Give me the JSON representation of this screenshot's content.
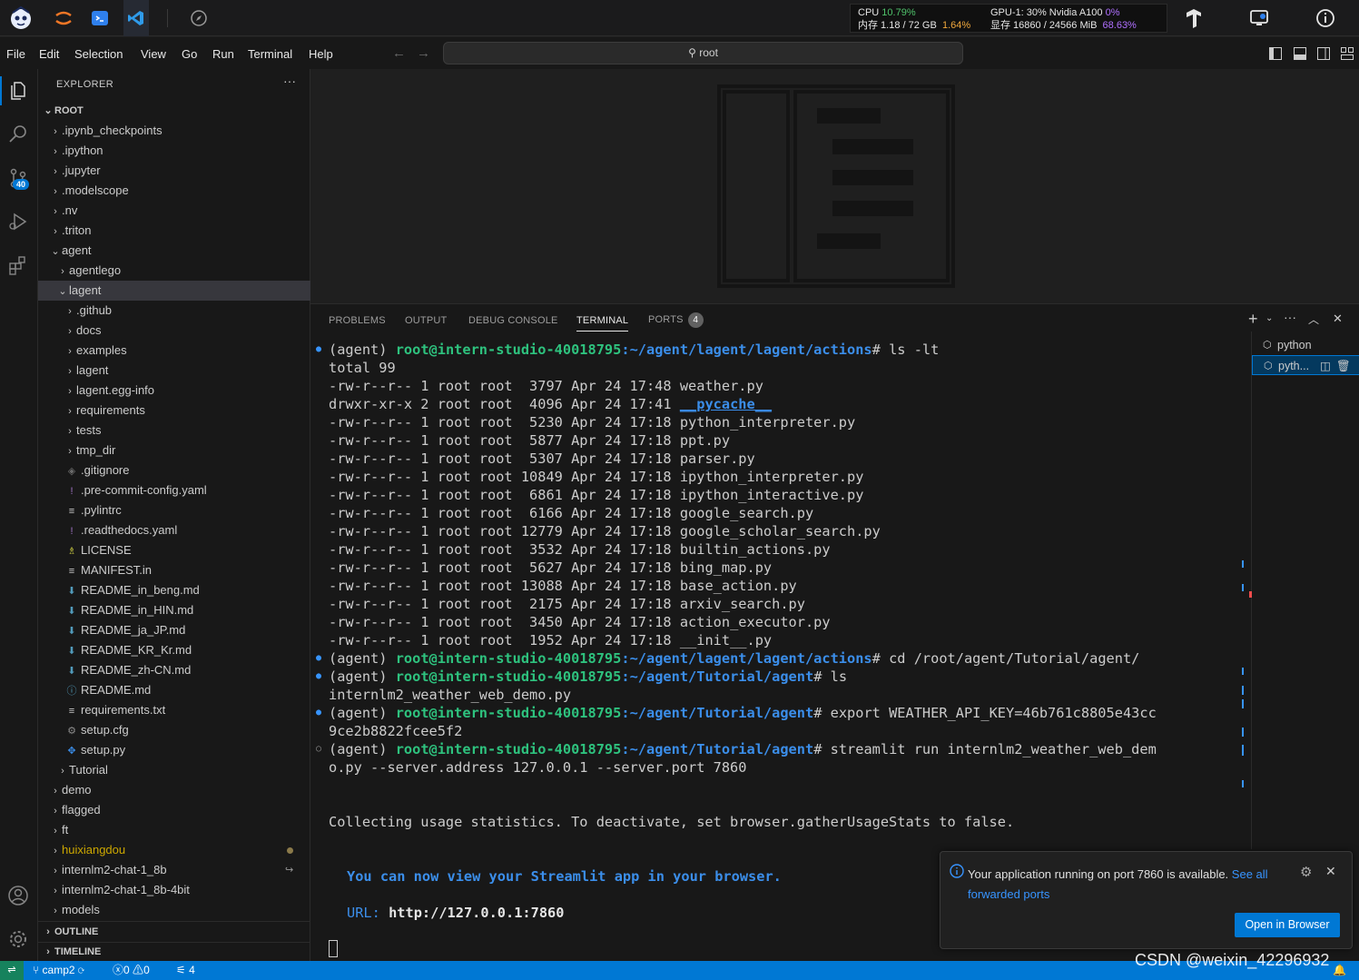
{
  "topbar": {
    "stats": {
      "cpu_label": "CPU",
      "cpu_value": "10.79%",
      "mem_label": "内存 1.18 / 72 GB",
      "mem_value": "1.64%",
      "gpu_label": "GPU-1: 30% Nvidia A100",
      "gpu_value": "0%",
      "vram_label": "显存 16860 / 24566 MiB",
      "vram_value": "68.63%"
    }
  },
  "menubar": {
    "items": [
      "File",
      "Edit",
      "Selection",
      "View",
      "Go",
      "Run",
      "Terminal",
      "Help"
    ],
    "search_text": "root"
  },
  "activity": {
    "scm_badge": "40"
  },
  "sidebar": {
    "title": "EXPLORER",
    "root_label": "ROOT",
    "rows": [
      {
        "label": ".ipynb_checkpoints"
      },
      {
        "label": ".ipython"
      },
      {
        "label": ".jupyter"
      },
      {
        "label": ".modelscope"
      },
      {
        "label": ".nv"
      },
      {
        "label": ".triton"
      },
      {
        "label": "agent"
      },
      {
        "label": "agentlego"
      },
      {
        "label": "lagent"
      },
      {
        "label": ".github"
      },
      {
        "label": "docs"
      },
      {
        "label": "examples"
      },
      {
        "label": "lagent"
      },
      {
        "label": "lagent.egg-info"
      },
      {
        "label": "requirements"
      },
      {
        "label": "tests"
      },
      {
        "label": "tmp_dir"
      },
      {
        "label": ".gitignore"
      },
      {
        "label": ".pre-commit-config.yaml"
      },
      {
        "label": ".pylintrc"
      },
      {
        "label": ".readthedocs.yaml"
      },
      {
        "label": "LICENSE"
      },
      {
        "label": "MANIFEST.in"
      },
      {
        "label": "README_in_beng.md"
      },
      {
        "label": "README_in_HIN.md"
      },
      {
        "label": "README_ja_JP.md"
      },
      {
        "label": "README_KR_Kr.md"
      },
      {
        "label": "README_zh-CN.md"
      },
      {
        "label": "README.md"
      },
      {
        "label": "requirements.txt"
      },
      {
        "label": "setup.cfg"
      },
      {
        "label": "setup.py"
      },
      {
        "label": "Tutorial"
      },
      {
        "label": "demo"
      },
      {
        "label": "flagged"
      },
      {
        "label": "ft"
      },
      {
        "label": "huixiangdou"
      },
      {
        "label": "internlm2-chat-1_8b"
      },
      {
        "label": "internlm2-chat-1_8b-4bit"
      },
      {
        "label": "models"
      }
    ],
    "outline_label": "OUTLINE",
    "timeline_label": "TIMELINE"
  },
  "panel": {
    "tabs": [
      "PROBLEMS",
      "OUTPUT",
      "DEBUG CONSOLE",
      "TERMINAL",
      "PORTS"
    ],
    "ports_count": "4",
    "terminals": [
      "python",
      "pyth..."
    ]
  },
  "terminal": {
    "env": "(agent)",
    "user_host": "root@intern-studio-40018795",
    "prompt1_path": ":~/agent/lagent/lagent/actions",
    "prompt1_cmd": "# ls -lt",
    "total": "total 99",
    "files": [
      {
        "meta": "-rw-r--r-- 1 root root  3797 Apr 24 17:48",
        "name": "weather.py",
        "dir": false
      },
      {
        "meta": "drwxr-xr-x 2 root root  4096 Apr 24 17:41",
        "name": "__pycache__",
        "dir": true
      },
      {
        "meta": "-rw-r--r-- 1 root root  5230 Apr 24 17:18",
        "name": "python_interpreter.py",
        "dir": false
      },
      {
        "meta": "-rw-r--r-- 1 root root  5877 Apr 24 17:18",
        "name": "ppt.py",
        "dir": false
      },
      {
        "meta": "-rw-r--r-- 1 root root  5307 Apr 24 17:18",
        "name": "parser.py",
        "dir": false
      },
      {
        "meta": "-rw-r--r-- 1 root root 10849 Apr 24 17:18",
        "name": "ipython_interpreter.py",
        "dir": false
      },
      {
        "meta": "-rw-r--r-- 1 root root  6861 Apr 24 17:18",
        "name": "ipython_interactive.py",
        "dir": false
      },
      {
        "meta": "-rw-r--r-- 1 root root  6166 Apr 24 17:18",
        "name": "google_search.py",
        "dir": false
      },
      {
        "meta": "-rw-r--r-- 1 root root 12779 Apr 24 17:18",
        "name": "google_scholar_search.py",
        "dir": false
      },
      {
        "meta": "-rw-r--r-- 1 root root  3532 Apr 24 17:18",
        "name": "builtin_actions.py",
        "dir": false
      },
      {
        "meta": "-rw-r--r-- 1 root root  5627 Apr 24 17:18",
        "name": "bing_map.py",
        "dir": false
      },
      {
        "meta": "-rw-r--r-- 1 root root 13088 Apr 24 17:18",
        "name": "base_action.py",
        "dir": false
      },
      {
        "meta": "-rw-r--r-- 1 root root  2175 Apr 24 17:18",
        "name": "arxiv_search.py",
        "dir": false
      },
      {
        "meta": "-rw-r--r-- 1 root root  3450 Apr 24 17:18",
        "name": "action_executor.py",
        "dir": false
      },
      {
        "meta": "-rw-r--r-- 1 root root  1952 Apr 24 17:18",
        "name": "__init__.py",
        "dir": false
      }
    ],
    "prompt2_cmd": "# cd /root/agent/Tutorial/agent/",
    "prompt3_path": ":~/agent/Tutorial/agent",
    "prompt3_cmd": "# ls",
    "ls_output": "internlm2_weather_web_demo.py",
    "prompt4_cmd": "# export WEATHER_API_KEY=46b761c8805e43cc",
    "prompt4_cont": "9ce2b8822fcee5f2",
    "prompt5_cmd": "# streamlit run internlm2_weather_web_dem",
    "prompt5_cont": "o.py --server.address 127.0.0.1 --server.port 7860",
    "collecting": "Collecting usage statistics. To deactivate, set browser.gatherUsageStats to false.",
    "streamlit_msg": "You can now view your Streamlit app in your browser.",
    "url_label": "URL:",
    "url_value": "http://127.0.0.1:7860"
  },
  "notification": {
    "text": "Your application running on port 7860 is available.",
    "link1": "See all",
    "link2": "forwarded ports",
    "button": "Open in Browser"
  },
  "status": {
    "branch": "camp2",
    "errors": "0",
    "warnings": "0",
    "ports": "4"
  },
  "watermark": "CSDN @weixin_42296932",
  "colors": {
    "accent": "#0078d4",
    "prompt_green": "#2ec27e",
    "prompt_blue": "#3b8eea",
    "remote": "#16825d"
  }
}
